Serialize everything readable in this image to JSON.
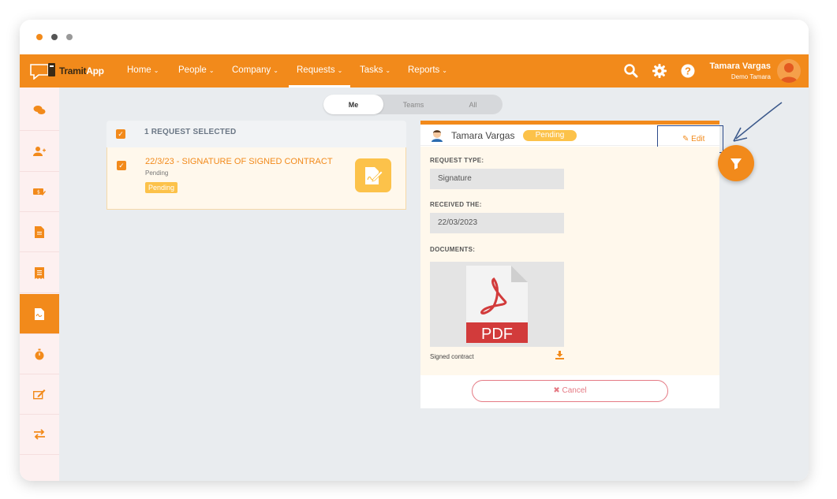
{
  "window": {
    "dots": [
      "#f28a1b",
      "#555555",
      "#999999"
    ]
  },
  "brand": {
    "name_part1": "Tramit",
    "name_part2": "App",
    "accent": "#f28a1b"
  },
  "nav": {
    "items": [
      {
        "label": "Home",
        "icon": "chevron-down-icon"
      },
      {
        "label": "People",
        "icon": "chevron-down-icon"
      },
      {
        "label": "Company",
        "icon": "chevron-down-icon"
      },
      {
        "label": "Requests",
        "icon": "chevron-down-icon",
        "active": true
      },
      {
        "label": "Tasks",
        "icon": "chevron-down-icon"
      },
      {
        "label": "Reports",
        "icon": "chevron-down-icon"
      }
    ],
    "icons": [
      "search-icon",
      "gear-icon",
      "help-icon"
    ],
    "user": {
      "name": "Tamara Vargas",
      "company": "Demo Tamara"
    }
  },
  "sidebar": {
    "items": [
      {
        "icon": "chat-icon"
      },
      {
        "icon": "add-user-icon"
      },
      {
        "icon": "expense-icon"
      },
      {
        "icon": "document-icon"
      },
      {
        "icon": "receipt-icon"
      },
      {
        "icon": "signature-doc-icon",
        "active": true
      },
      {
        "icon": "stopwatch-icon"
      },
      {
        "icon": "sign-icon"
      },
      {
        "icon": "exchange-icon"
      }
    ]
  },
  "filter": {
    "options": [
      "Me",
      "Teams",
      "All"
    ],
    "selected": "Me"
  },
  "list": {
    "header": "1 REQUEST SELECTED",
    "items": [
      {
        "title": "22/3/23 - SIGNATURE OF SIGNED CONTRACT",
        "subtitle": "Pending",
        "badge": "Pending"
      }
    ]
  },
  "detail": {
    "user_name": "Tamara Vargas",
    "status": "Pending",
    "edit_label": "Edit",
    "request_type_label": "REQUEST TYPE:",
    "request_type_value": "Signature",
    "received_label": "RECEIVED THE:",
    "received_value": "22/03/2023",
    "documents_label": "DOCUMENTS:",
    "document_type": "PDF",
    "document_name": "Signed contract",
    "cancel_label": "Cancel"
  }
}
